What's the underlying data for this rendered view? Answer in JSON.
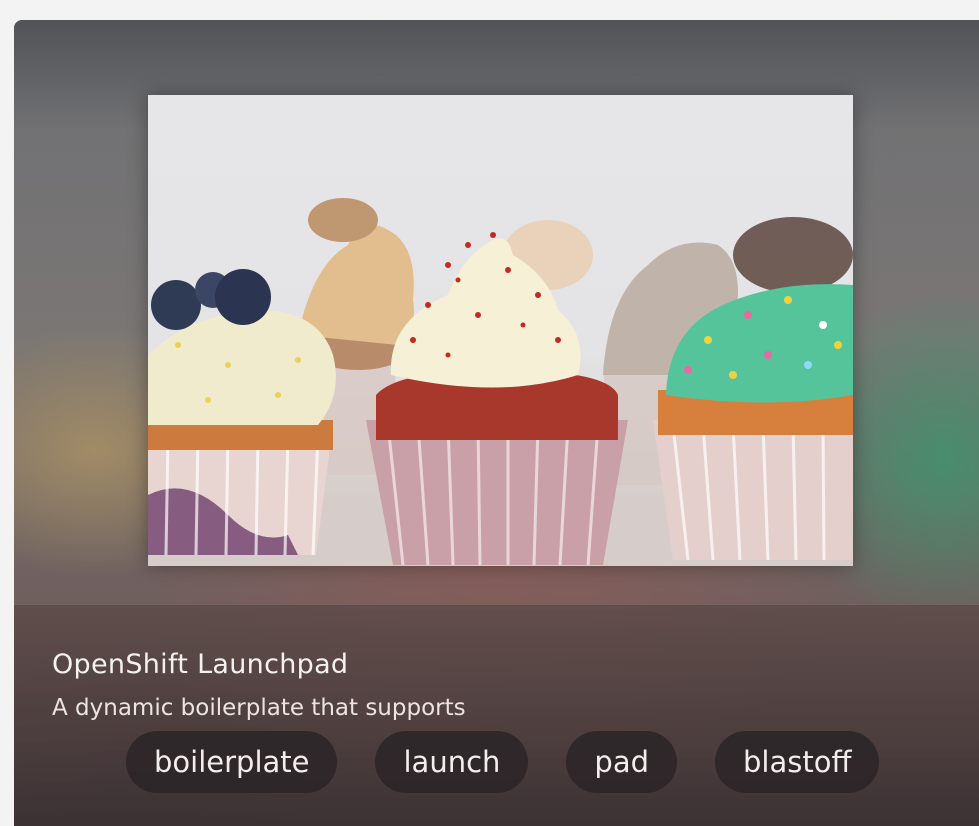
{
  "app": {
    "title": "OpenShift Launchpad",
    "description": "A dynamic boilerplate that supports",
    "tags": [
      {
        "label": "boilerplate"
      },
      {
        "label": "launch"
      },
      {
        "label": "pad"
      },
      {
        "label": "blastoff"
      }
    ]
  },
  "colors": {
    "page_background": "#f3f3f3",
    "tag_background": "#2c2628",
    "text_light": "#f4f1ef"
  }
}
